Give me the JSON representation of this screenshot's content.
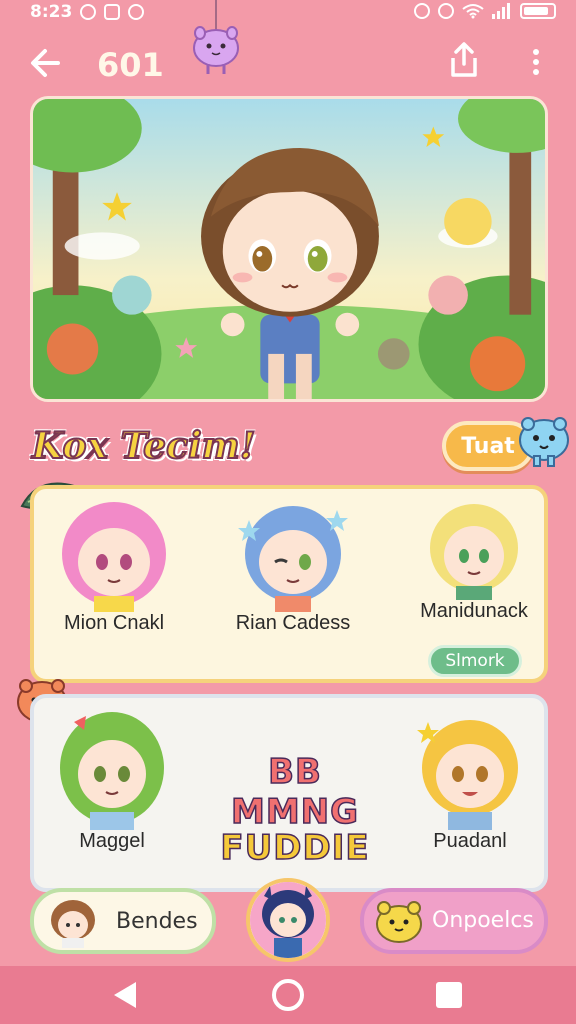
{
  "status": {
    "time": "8:23"
  },
  "header": {
    "title": "601"
  },
  "section": {
    "heading": "Kox Tecim!",
    "pill_label": "Tuat"
  },
  "grid1": [
    {
      "name": "Mion Cnakl",
      "hair": "#f28ac8"
    },
    {
      "name": "Rian Cadess",
      "hair": "#7ba5e0"
    },
    {
      "name": "Manidunack",
      "hair": "#f3e07a"
    }
  ],
  "grid1_action": "Slmork",
  "grid2": [
    {
      "name": "Maggel",
      "hair": "#7cc04a"
    },
    {
      "name": "Puadanl",
      "hair": "#f5c542"
    }
  ],
  "logo": {
    "line1": "BB MMNG",
    "line2": "FUDDIE"
  },
  "bottom": {
    "left_label": "Bendes",
    "right_label": "Onpoelcs"
  },
  "colors": {
    "background": "#f39aa8",
    "navbar": "#e97b91",
    "accent": "#f7b94a"
  }
}
